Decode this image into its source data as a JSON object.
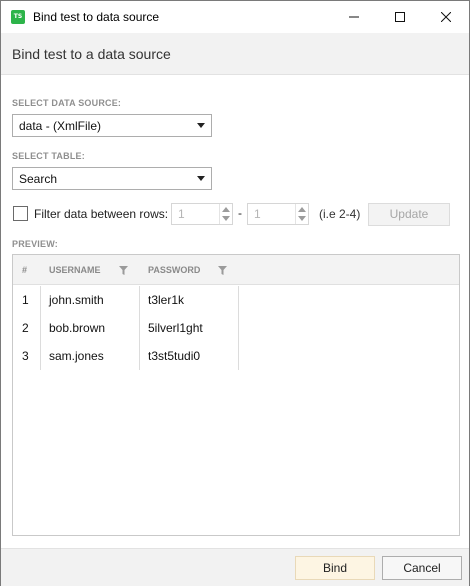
{
  "window": {
    "title": "Bind test to data source",
    "app_icon_text": "TS",
    "app_icon_color": "#2db44a"
  },
  "header": {
    "title": "Bind test to a data source"
  },
  "datasource": {
    "label": "SELECT DATA SOURCE:",
    "selected": "data - (XmlFile)"
  },
  "table": {
    "label": "SELECT TABLE:",
    "selected": "Search"
  },
  "filter": {
    "checkbox_label": "Filter data between rows:",
    "checked": false,
    "from_value": "1",
    "separator": "-",
    "to_value": "1",
    "hint": "(i.e 2-4)",
    "update_label": "Update"
  },
  "preview": {
    "label": "PREVIEW:",
    "columns": [
      "#",
      "USERNAME",
      "PASSWORD"
    ],
    "rows": [
      [
        "1",
        "john.smith",
        "t3ler1k"
      ],
      [
        "2",
        "bob.brown",
        "5ilverl1ght"
      ],
      [
        "3",
        "sam.jones",
        "t3st5tudi0"
      ]
    ]
  },
  "footer": {
    "bind_label": "Bind",
    "cancel_label": "Cancel",
    "bind_accent": "#fdf5e3"
  }
}
